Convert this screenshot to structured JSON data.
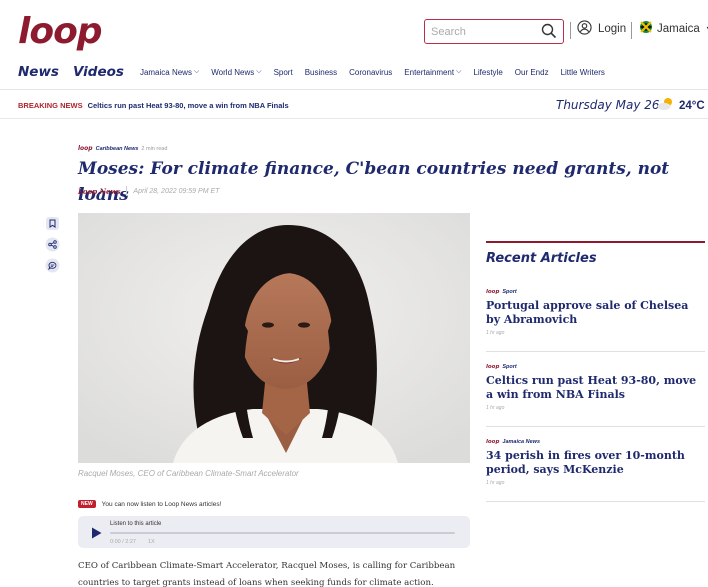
{
  "header": {
    "logo": "loop",
    "search_placeholder": "Search",
    "login_label": "Login",
    "country_label": "Jamaica"
  },
  "nav": {
    "primary": [
      "News",
      "Videos"
    ],
    "items": [
      {
        "label": "Jamaica News",
        "has_menu": true
      },
      {
        "label": "World News",
        "has_menu": true
      },
      {
        "label": "Sport",
        "has_menu": false
      },
      {
        "label": "Business",
        "has_menu": false
      },
      {
        "label": "Coronavirus",
        "has_menu": false
      },
      {
        "label": "Entertainment",
        "has_menu": true
      },
      {
        "label": "Lifestyle",
        "has_menu": false
      },
      {
        "label": "Our Endz",
        "has_menu": false
      },
      {
        "label": "Little Writers",
        "has_menu": false
      }
    ]
  },
  "breaking": {
    "tag": "BREAKING NEWS",
    "text": "Celtics run past Heat 93-80, move a win from NBA Finals"
  },
  "date": "Thursday May 26",
  "weather": {
    "temp": "24°C"
  },
  "article": {
    "kicker_logo": "loop",
    "category": "Caribbean News",
    "read_time": "2 min read",
    "headline": "Moses: For climate finance, C'bean countries need grants, not loans",
    "author": "Loop News",
    "published": "April 28, 2022 09:59 PM ET",
    "caption": "Racquel Moses, CEO of Caribbean Climate-Smart Accelerator",
    "listen_badge": "NEW",
    "listen_notice": "You can now listen to Loop News articles!",
    "player_title": "Listen to this article",
    "player_time": "0:00 / 2:27",
    "player_speed": "1X",
    "body": "CEO of Caribbean Climate-Smart Accelerator, Racquel Moses, is calling for Caribbean countries to target grants instead of loans when seeking funds for climate action."
  },
  "sidebar": {
    "title": "Recent Articles",
    "articles": [
      {
        "logo": "loop",
        "category": "Sport",
        "title": "Portugal approve sale of Chelsea by Abramovich",
        "ago": "1 hr ago"
      },
      {
        "logo": "loop",
        "category": "Sport",
        "title": "Celtics run past Heat 93-80, move a win from NBA Finals",
        "ago": "1 hr ago"
      },
      {
        "logo": "loop",
        "category": "Jamaica News",
        "title": "34 perish in fires over 10-month period, says McKenzie",
        "ago": "1 hr ago"
      }
    ]
  },
  "colors": {
    "brand": "#8e1a30",
    "navy": "#1f2a6e",
    "breaking": "#b0242e"
  }
}
